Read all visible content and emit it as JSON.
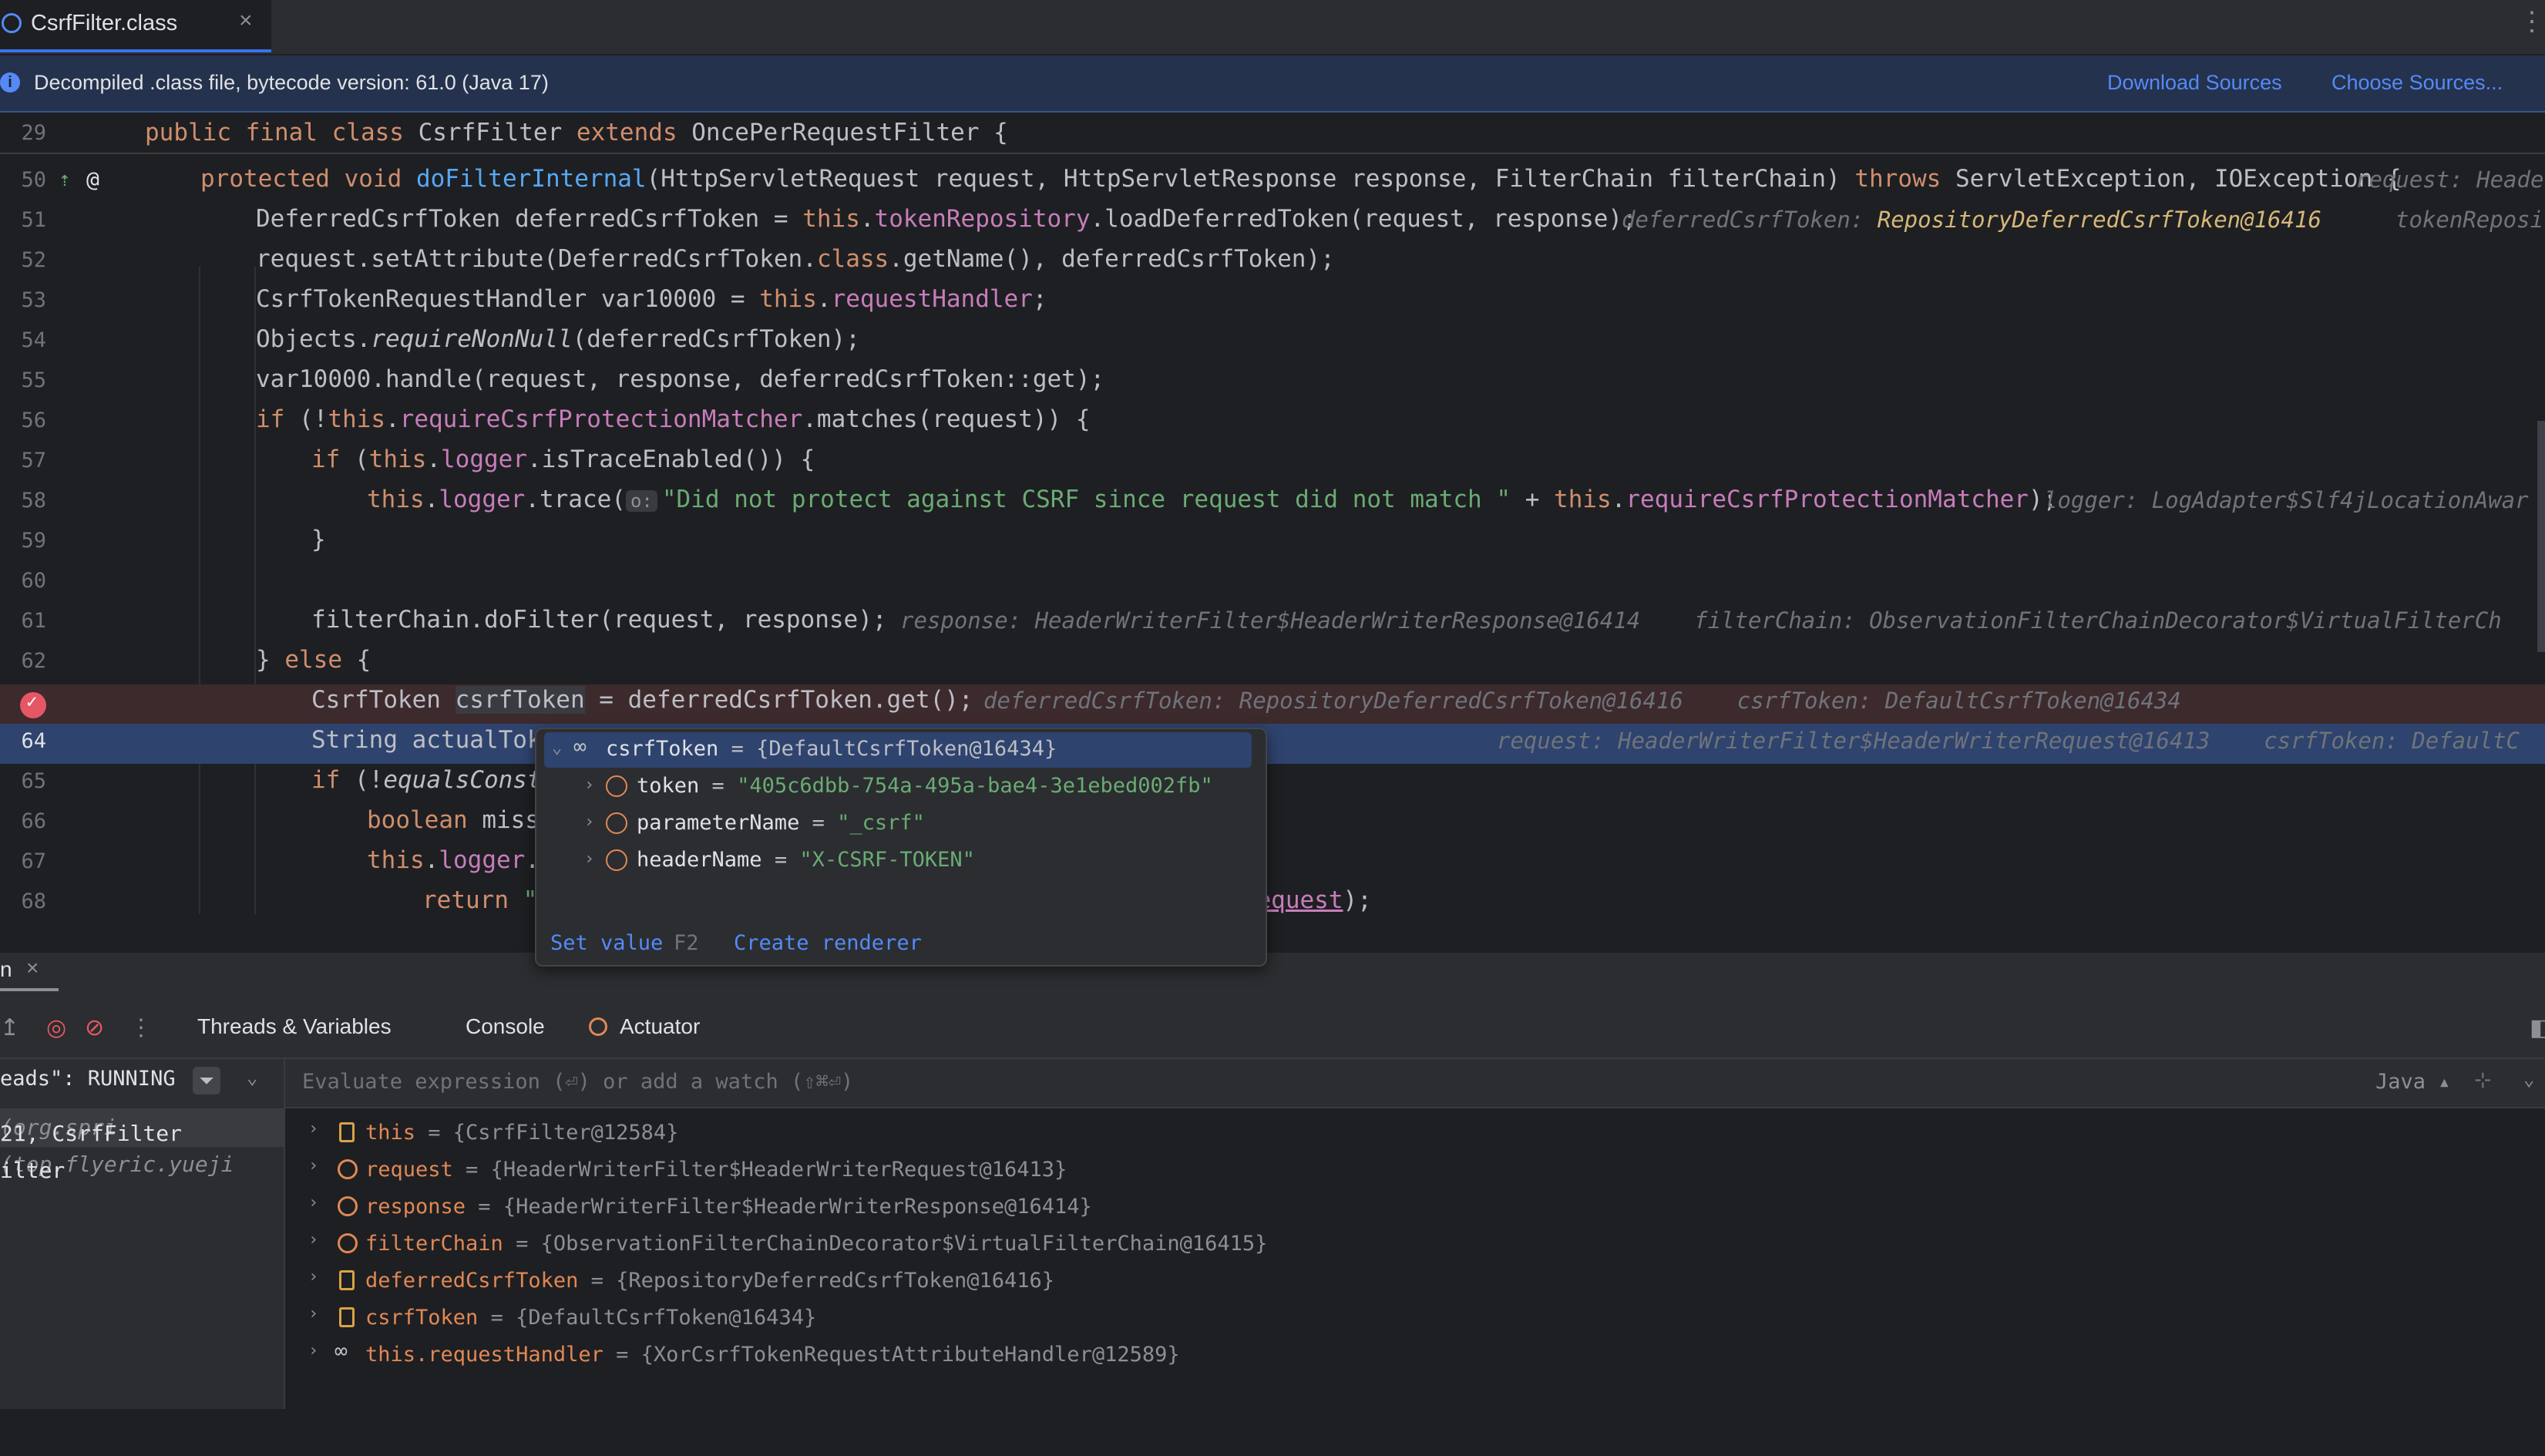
{
  "tab": {
    "label": "CsrfFilter.class",
    "close": "×"
  },
  "banner": {
    "text": "Decompiled .class file, bytecode version: 61.0 (Java 17)",
    "download": "Download Sources",
    "choose": "Choose Sources..."
  },
  "editor": {
    "ln29": "29",
    "ln50": "50",
    "ln51": "51",
    "ln52": "52",
    "ln53": "53",
    "ln54": "54",
    "ln55": "55",
    "ln56": "56",
    "ln57": "57",
    "ln58": "58",
    "ln59": "59",
    "ln60": "60",
    "ln61": "61",
    "ln62": "62",
    "ln64": "64",
    "ln65": "65",
    "ln66": "66",
    "ln67": "67",
    "ln68": "68",
    "hint50": "request: Heade",
    "hint51a": "deferredCsrfToken: ",
    "hint51b": "RepositoryDeferredCsrfToken@16416",
    "hint51c": "tokenReposi",
    "hint58": "logger: LogAdapter$Slf4jLocationAwar",
    "hint61": "response: HeaderWriterFilter$HeaderWriterResponse@16414    filterChain: ObservationFilterChainDecorator$VirtualFilterCh",
    "hint63": "deferredCsrfToken: RepositoryDeferredCsrfToken@16416    csrfToken: DefaultCsrfToken@16434",
    "hint64": "request: HeaderWriterFilter$HeaderWriterRequest@16413    csrfToken: DefaultC"
  },
  "popup": {
    "root_name": "csrfToken",
    "root_value": " = {DefaultCsrfToken@16434}",
    "fields": [
      {
        "name": "token",
        "eq": " = ",
        "value": "\"405c6dbb-754a-495a-bae4-3e1ebed002fb\""
      },
      {
        "name": "parameterName",
        "eq": " = ",
        "value": "\"_csrf\""
      },
      {
        "name": "headerName",
        "eq": " = ",
        "value": "\"X-CSRF-TOKEN\""
      }
    ],
    "set_value": "Set value",
    "set_value_key": "F2",
    "create_renderer": "Create renderer"
  },
  "debug": {
    "title": "n",
    "tabs": {
      "threads_vars": "Threads & Variables",
      "console": "Console",
      "actuator": "Actuator"
    },
    "thread_header": "eads\": RUNNING",
    "frames": [
      {
        "text": "21, CsrfFilter ",
        "loc": "(org.spri"
      },
      {
        "text": "ilter ",
        "loc": "(top.flyeric.yueji"
      }
    ],
    "eval_placeholder": "Evaluate expression (⏎) or add a watch (⇧⌘⏎)",
    "lang": "Java ▴",
    "variables": [
      {
        "name": "this",
        "value": " = {CsrfFilter@12584}",
        "kind": "field"
      },
      {
        "name": "request",
        "value": " = {HeaderWriterFilter$HeaderWriterRequest@16413}",
        "kind": "param"
      },
      {
        "name": "response",
        "value": " = {HeaderWriterFilter$HeaderWriterResponse@16414}",
        "kind": "param"
      },
      {
        "name": "filterChain",
        "value": " = {ObservationFilterChainDecorator$VirtualFilterChain@16415}",
        "kind": "param"
      },
      {
        "name": "deferredCsrfToken",
        "value": " = {RepositoryDeferredCsrfToken@16416}",
        "kind": "field"
      },
      {
        "name": "csrfToken",
        "value": " = {DefaultCsrfToken@16434}",
        "kind": "field"
      },
      {
        "name": "this.requestHandler",
        "value": " = {XorCsrfTokenRequestAttributeHandler@12589}",
        "kind": "watch"
      }
    ]
  },
  "colors": {
    "accent": "#3574f0",
    "breakpoint": "#e55765",
    "current_line": "#2e436e"
  }
}
